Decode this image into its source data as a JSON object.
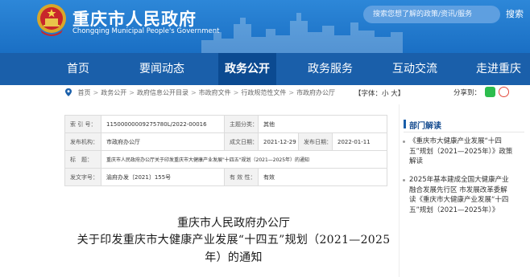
{
  "header": {
    "title": "重庆市人民政府",
    "subtitle": "Chongqing Municipal People's Government",
    "search_placeholder": "搜索您想了解的政策/资讯/服务",
    "search_button": "搜索",
    "colors": {
      "header_blue": "#1a6fc4",
      "nav_blue": "#1a5faa",
      "nav_active": "#0b4a91"
    }
  },
  "nav": {
    "items": [
      "首页",
      "要闻动态",
      "政务公开",
      "政务服务",
      "互动交流",
      "走进重庆"
    ],
    "active": "政务公开"
  },
  "breadcrumb": {
    "items": [
      "首页",
      "政务公开",
      "政府信息公开目录",
      "市政府文件",
      "行政规范性文件",
      "市政府办公厅"
    ],
    "separator": ">"
  },
  "font_size": {
    "label": "【字体：",
    "small": "小",
    "large": "大",
    "end": "】"
  },
  "share": {
    "label": "分享到：",
    "icons": [
      "wechat-icon",
      "weibo-icon"
    ]
  },
  "meta": {
    "index_label": "索 引 号：",
    "index_value": "11500000009275780L/2022-00016",
    "topic_label": "主题分类：",
    "topic_value": "其他",
    "issuer_label": "发布机构：",
    "issuer_value": "市政府办公厅",
    "created_label": "成文日期：",
    "created_value": "2021-12-29",
    "published_label": "发布日期：",
    "published_value": "2022-01-11",
    "title_label": "标　题：",
    "title_value": "重庆市人民政府办公厅关于印发重庆市大健康产业发展\"十四五\"规划（2021—2025年）的通知",
    "docno_label": "发文字号：",
    "docno_value": "渝府办发〔2021〕155号",
    "validity_label": "有 效 性：",
    "validity_value": "有效"
  },
  "document": {
    "line1": "重庆市人民政府办公厅",
    "line2": "关于印发重庆市大健康产业发展“十四五”规划（2021—2025",
    "line3": "年）的通知"
  },
  "sidebar": {
    "title": "部门解读",
    "items": [
      "《重庆市大健康产业发展“十四五”规划（2021—2025年）》政策解读",
      "2025年基本建成全国大健康产业融合发展先行区 市发展改革委解读《重庆市大健康产业发展“十四五”规划（2021—2025年）》"
    ]
  }
}
